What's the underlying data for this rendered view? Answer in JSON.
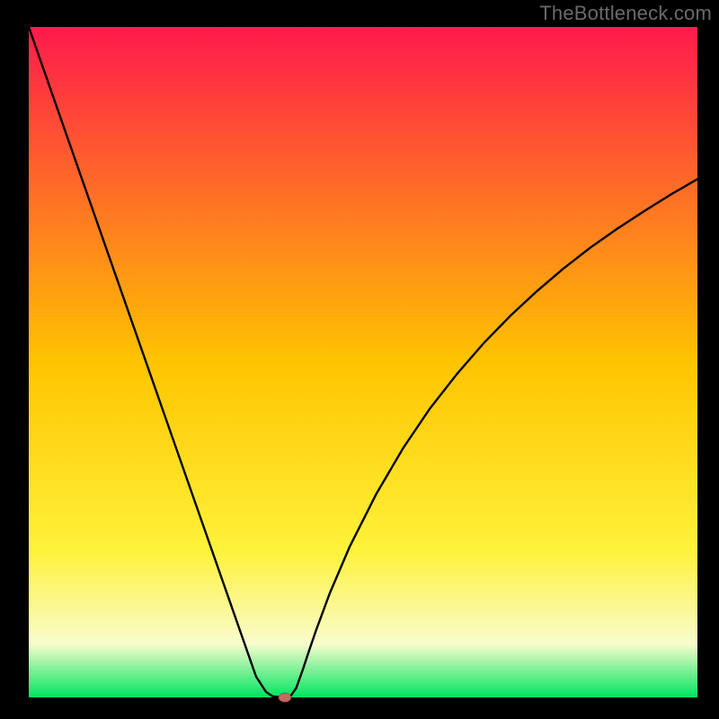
{
  "watermark": "TheBottleneck.com",
  "colors": {
    "frame": "#000000",
    "curve": "#000000",
    "marker_fill": "#c46a63",
    "marker_stroke": "#a9534c"
  },
  "chart_data": {
    "type": "line",
    "title": "",
    "xlabel": "",
    "ylabel": "",
    "xlim": [
      0,
      100
    ],
    "ylim": [
      0,
      100
    ],
    "background_gradient": [
      {
        "y": 100,
        "color": "#ff1a4c"
      },
      {
        "y": 50,
        "color": "#ffc400"
      },
      {
        "y": 22,
        "color": "#fff23a"
      },
      {
        "y": 8,
        "color": "#f8fccd"
      },
      {
        "y": 0,
        "color": "#00e55f"
      }
    ],
    "series": [
      {
        "name": "bottleneck-curve",
        "x": [
          0,
          2,
          4,
          6,
          8,
          10,
          12,
          14,
          16,
          18,
          20,
          22,
          24,
          26,
          28,
          30,
          32,
          34,
          35.5,
          36.5,
          37.5,
          38.3,
          39,
          40,
          41,
          42,
          43,
          45,
          48,
          52,
          56,
          60,
          64,
          68,
          72,
          76,
          80,
          84,
          88,
          92,
          96,
          100
        ],
        "y": [
          100,
          94.3,
          88.6,
          82.9,
          77.2,
          71.5,
          65.8,
          60.1,
          54.4,
          48.7,
          43.0,
          37.3,
          31.6,
          25.9,
          20.2,
          14.5,
          8.8,
          3.1,
          0.8,
          0.15,
          0.05,
          0.0,
          0.0,
          1.4,
          4.2,
          7.2,
          10.1,
          15.5,
          22.5,
          30.4,
          37.2,
          43.1,
          48.2,
          52.8,
          56.9,
          60.6,
          64.0,
          67.1,
          69.9,
          72.5,
          75.0,
          77.3
        ]
      }
    ],
    "marker": {
      "x": 38.3,
      "y": 0.0,
      "rx": 0.9,
      "ry": 0.65
    }
  }
}
